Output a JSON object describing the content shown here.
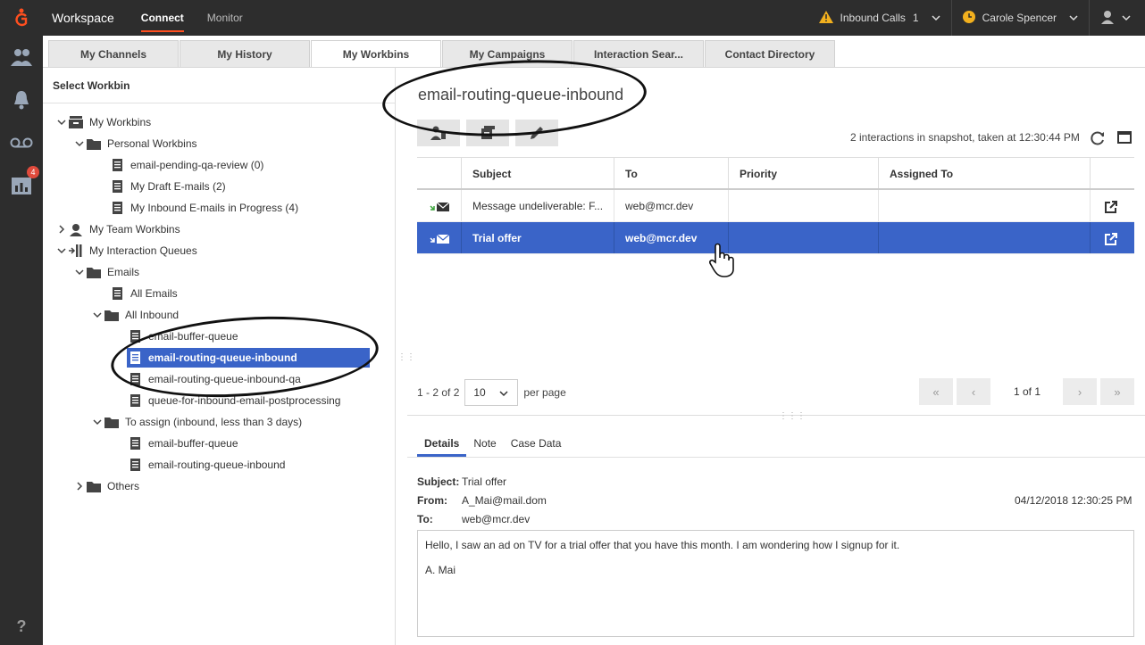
{
  "topbar": {
    "app_title": "Workspace",
    "nav": [
      {
        "label": "Connect",
        "active": true
      },
      {
        "label": "Monitor",
        "active": false
      }
    ],
    "inbound_label": "Inbound Calls",
    "inbound_count": "1",
    "user_name": "Carole Spencer"
  },
  "rail": {
    "badge_count": "4",
    "help": "?"
  },
  "tabs": [
    "My Channels",
    "My History",
    "My Workbins",
    "My Campaigns",
    "Interaction Sear...",
    "Contact Directory"
  ],
  "tree": {
    "header": "Select Workbin",
    "items": [
      {
        "label": "My Workbins"
      },
      {
        "label": "Personal Workbins"
      },
      {
        "label": "email-pending-qa-review (0)"
      },
      {
        "label": "My Draft E-mails (2)"
      },
      {
        "label": "My Inbound E-mails in Progress (4)"
      },
      {
        "label": "My Team Workbins"
      },
      {
        "label": "My Interaction Queues"
      },
      {
        "label": "Emails"
      },
      {
        "label": "All Emails"
      },
      {
        "label": "All Inbound"
      },
      {
        "label": "email-buffer-queue"
      },
      {
        "label": "email-routing-queue-inbound"
      },
      {
        "label": "email-routing-queue-inbound-qa"
      },
      {
        "label": "queue-for-inbound-email-postprocessing"
      },
      {
        "label": "To assign (inbound, less than 3 days)"
      },
      {
        "label": "email-buffer-queue"
      },
      {
        "label": "email-routing-queue-inbound"
      },
      {
        "label": "Others"
      }
    ]
  },
  "queue": {
    "title": "email-routing-queue-inbound",
    "snapshot": "2 interactions in snapshot, taken at 12:30:44 PM"
  },
  "grid": {
    "columns": [
      "",
      "Subject",
      "To",
      "Priority",
      "Assigned To",
      ""
    ],
    "rows": [
      {
        "subject": "Message undeliverable: F...",
        "to": "web@mcr.dev",
        "priority": "",
        "assigned": ""
      },
      {
        "subject": "Trial offer",
        "to": "web@mcr.dev",
        "priority": "",
        "assigned": ""
      }
    ]
  },
  "pager": {
    "range": "1 - 2 of 2",
    "per_page_value": "10",
    "per_page_label": "per page",
    "page_of": "1 of 1"
  },
  "details": {
    "tabs": [
      "Details",
      "Note",
      "Case Data"
    ],
    "subject_label": "Subject:",
    "subject": "Trial offer",
    "from_label": "From:",
    "from": "A_Mai@mail.dom",
    "to_label": "To:",
    "to": "web@mcr.dev",
    "date": "04/12/2018 12:30:25 PM",
    "body_line1": "Hello, I saw an ad on TV for a trial offer that you have this month. I am wondering how I signup for it.",
    "body_line2": "A. Mai"
  },
  "colors": {
    "selection": "#3a64c8",
    "topbar": "#2d2d2d",
    "accent": "#ff4f1f",
    "warning": "#f2b01e"
  },
  "icons": [
    "genesys-logo-icon",
    "warning-icon",
    "status-clock-icon",
    "agent-icon",
    "contacts-icon",
    "bell-icon",
    "voicemail-icon",
    "reports-icon",
    "folder-icon",
    "workbin-icon",
    "email-icon",
    "refresh-icon",
    "maximize-icon",
    "popout-icon",
    "edit-icon"
  ]
}
